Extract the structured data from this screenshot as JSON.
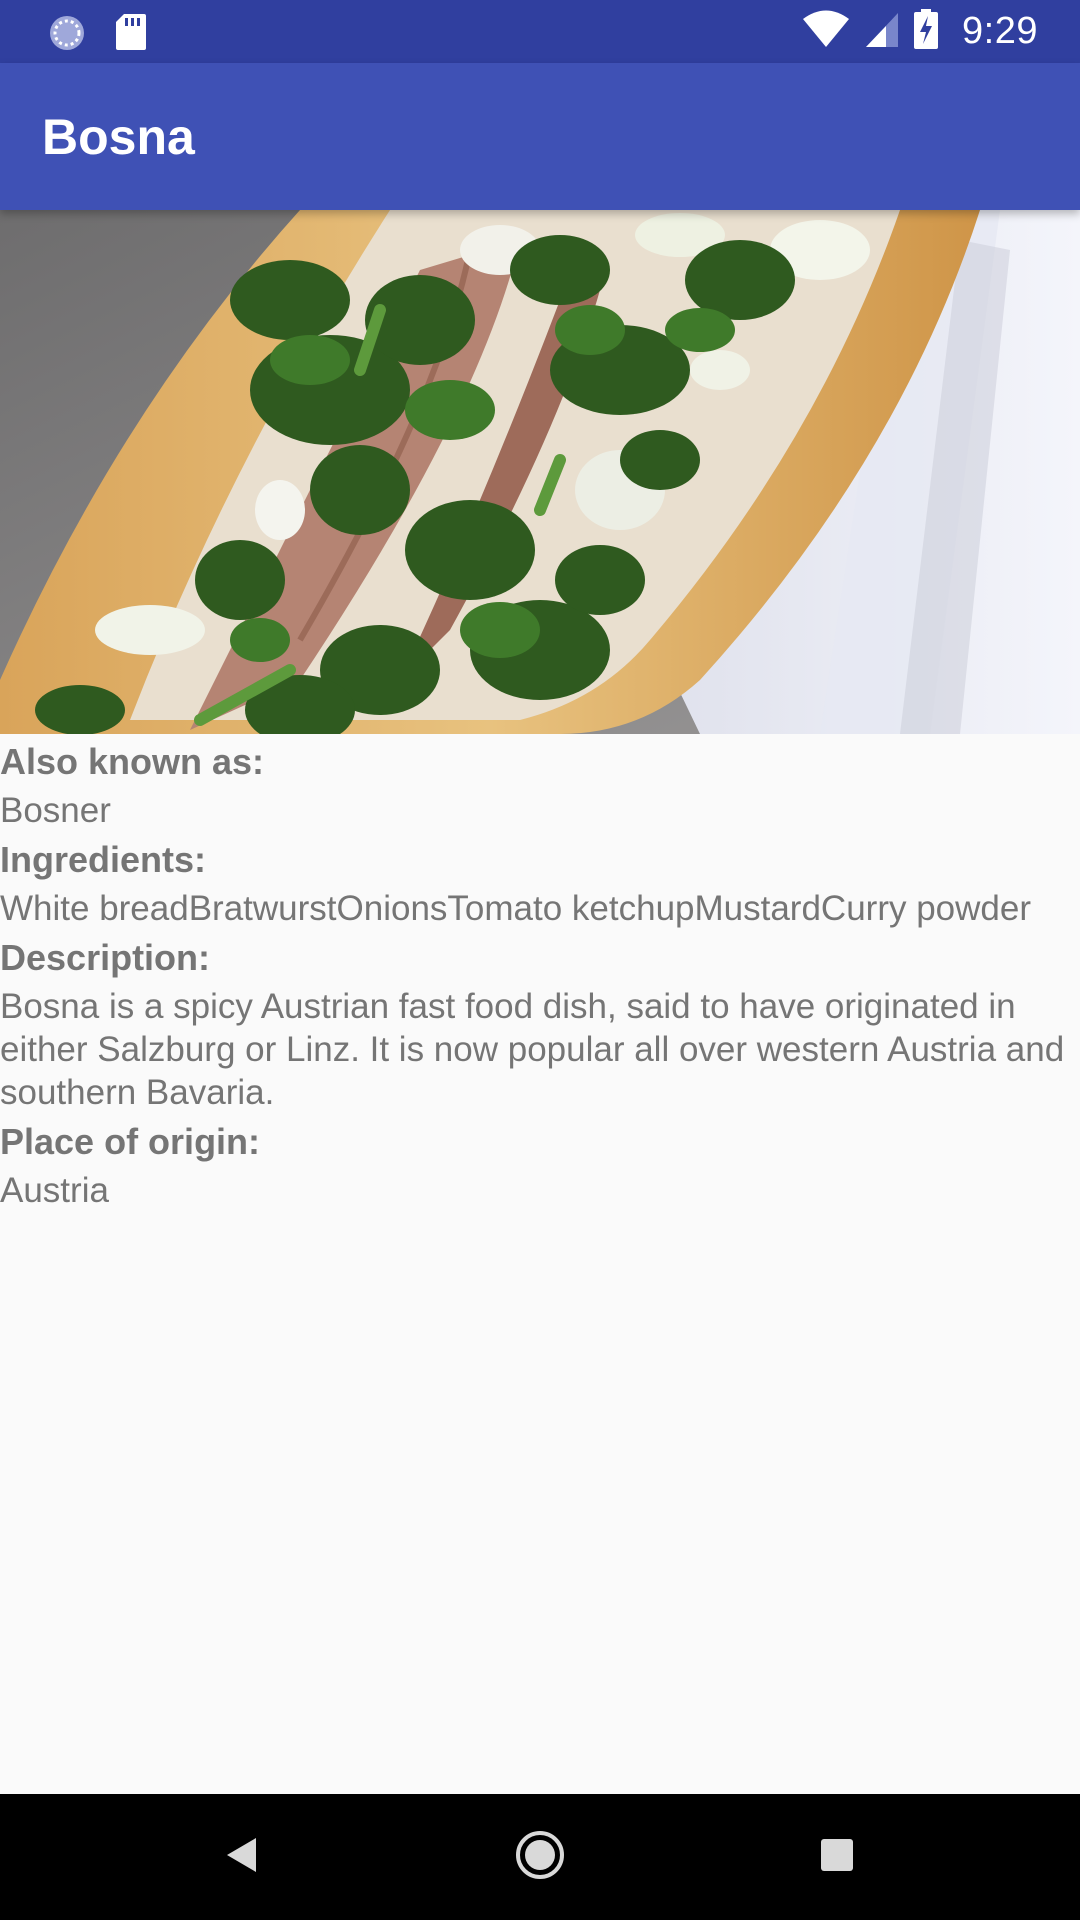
{
  "status_bar": {
    "time": "9:29",
    "left_icons": [
      "sync-icon",
      "sd-card-icon"
    ],
    "right_icons": [
      "wifi-icon",
      "signal-icon",
      "battery-charging-icon"
    ]
  },
  "app_bar": {
    "title": "Bosna"
  },
  "hero_image": {
    "subject": "bosna-sandwich-photo"
  },
  "details": {
    "also_known_as_label": "Also known as:",
    "also_known_as_value": "Bosner",
    "ingredients_label": "Ingredients:",
    "ingredients_value": "White breadBratwurstOnionsTomato ketchupMustardCurry powder",
    "description_label": "Description:",
    "description_value": "Bosna is a spicy Austrian fast food dish, said to have originated in either Salzburg or Linz. It is now popular all over western Austria and southern Bavaria.",
    "origin_label": "Place of origin:",
    "origin_value": "Austria"
  },
  "nav_bar": {
    "buttons": [
      "back-icon",
      "home-icon",
      "recents-icon"
    ]
  },
  "colors": {
    "status_bar": "#303f9f",
    "app_bar": "#3f51b5",
    "background": "#fafafa",
    "text": "#757575",
    "nav_bar": "#000000"
  }
}
